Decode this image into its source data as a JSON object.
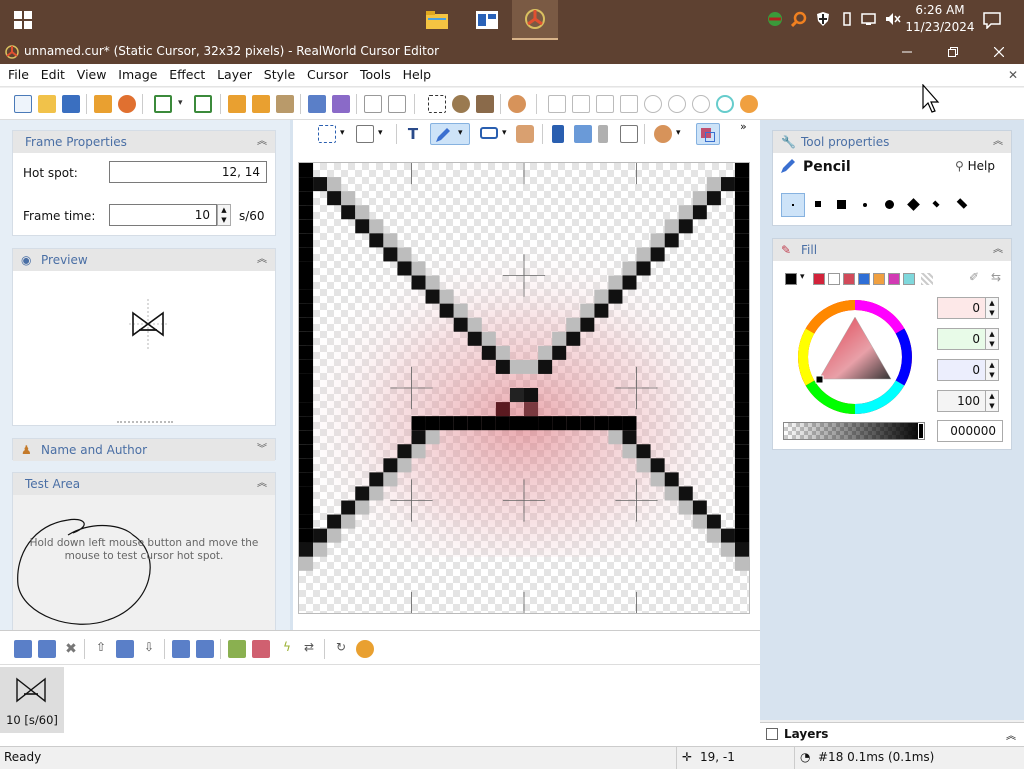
{
  "taskbar": {
    "clock_time": "6:26 AM",
    "clock_date": "11/23/2024"
  },
  "window": {
    "title": "unnamed.cur* (Static Cursor, 32x32 pixels) - RealWorld Cursor Editor"
  },
  "menu": [
    "File",
    "Edit",
    "View",
    "Image",
    "Effect",
    "Layer",
    "Style",
    "Cursor",
    "Tools",
    "Help"
  ],
  "frame_properties": {
    "header": "Frame Properties",
    "hotspot_label": "Hot spot:",
    "hotspot_value": "12, 14",
    "frame_time_label": "Frame time:",
    "frame_time_value": "10",
    "frame_time_unit": "s/60"
  },
  "preview": {
    "header": "Preview"
  },
  "name_author": {
    "header": "Name and Author"
  },
  "test_area": {
    "header": "Test Area",
    "hint": "Hold down left mouse button and move the mouse to test cursor hot spot."
  },
  "tool_properties": {
    "header": "Tool properties",
    "tool_name": "Pencil",
    "help_label": "Help"
  },
  "fill": {
    "header": "Fill",
    "swatches": [
      "#000000",
      "#ffffff",
      "#d2223a",
      "#ffffff",
      "#d24a5a",
      "#2f6fd6",
      "#f0a040",
      "#d23ab4",
      "#7fd8dc"
    ],
    "values": [
      "0",
      "0",
      "0",
      "100"
    ],
    "hex": "000000"
  },
  "frames": [
    {
      "label": "10 [s/60]"
    }
  ],
  "layers": {
    "header": "Layers"
  },
  "status": {
    "ready": "Ready",
    "coords": "19, -1",
    "frame_info": "#18 0.1ms (0.1ms)"
  }
}
